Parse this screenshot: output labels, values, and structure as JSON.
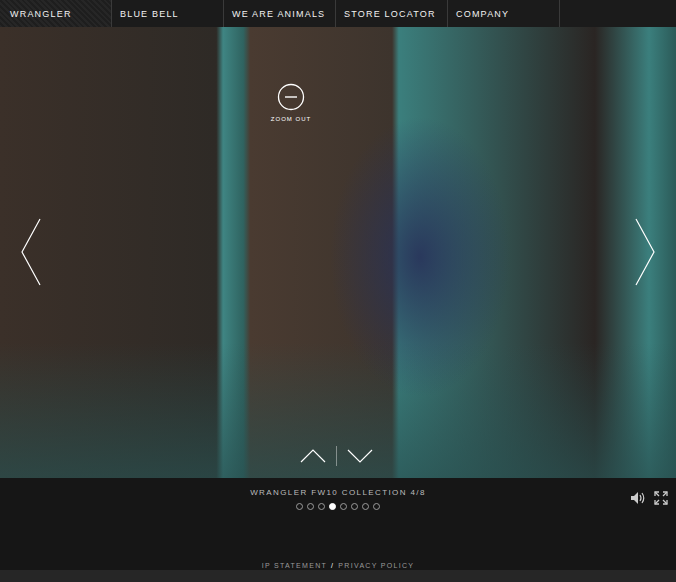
{
  "nav": [
    {
      "label": "WRANGLER",
      "selected": true
    },
    {
      "label": "BLUE BELL",
      "selected": false
    },
    {
      "label": "WE ARE ANIMALS",
      "selected": false
    },
    {
      "label": "STORE LOCATOR",
      "selected": false
    },
    {
      "label": "COMPANY",
      "selected": false
    }
  ],
  "viewer": {
    "zoom_label": "ZOOM OUT"
  },
  "caption": "WRANGLER FW10 COLLECTION 4/8",
  "dots": [
    {
      "selected": false
    },
    {
      "selected": false
    },
    {
      "selected": false
    },
    {
      "selected": true
    },
    {
      "selected": false
    },
    {
      "selected": false
    },
    {
      "selected": false
    },
    {
      "selected": false
    }
  ],
  "footer": {
    "links": [
      "IP STATEMENT",
      "PRIVACY POLICY"
    ],
    "separator": "/"
  }
}
